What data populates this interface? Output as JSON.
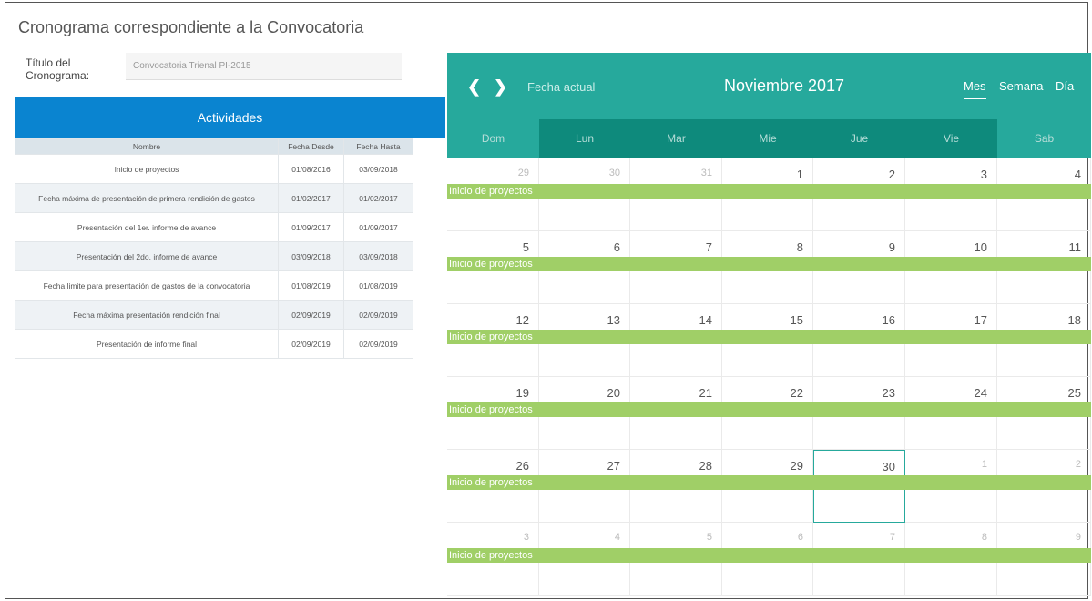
{
  "page": {
    "title": "Cronograma correspondiente a la Convocatoria"
  },
  "meta": {
    "label_line1": "Título del",
    "label_line2": "Cronograma:",
    "value": "Convocatoria Trienal PI-2015"
  },
  "activities": {
    "title": "Actividades",
    "columns": [
      "Nombre",
      "Fecha Desde",
      "Fecha Hasta"
    ],
    "rows": [
      [
        "Inicio de proyectos",
        "01/08/2016",
        "03/09/2018"
      ],
      [
        "Fecha máxima de presentación de primera rendición de gastos",
        "01/02/2017",
        "01/02/2017"
      ],
      [
        "Presentación del 1er. informe de avance",
        "01/09/2017",
        "01/09/2017"
      ],
      [
        "Presentación del 2do. informe de avance",
        "03/09/2018",
        "03/09/2018"
      ],
      [
        "Fecha limite para presentación de gastos de la convocatoria",
        "01/08/2019",
        "01/08/2019"
      ],
      [
        "Fecha máxima presentación rendición final",
        "02/09/2019",
        "02/09/2019"
      ],
      [
        "Presentación de informe final",
        "02/09/2019",
        "02/09/2019"
      ]
    ]
  },
  "calendar": {
    "prev_icon": "chevron-left-icon",
    "next_icon": "chevron-right-icon",
    "today_label": "Fecha actual",
    "month_label": "Noviembre 2017",
    "views": [
      "Mes",
      "Semana",
      "Día"
    ],
    "active_view": "Mes",
    "weekdays": [
      "Dom",
      "Lun",
      "Mar",
      "Mie",
      "Jue",
      "Vie",
      "Sab"
    ],
    "weeks": [
      [
        [
          "29",
          true
        ],
        [
          "30",
          true
        ],
        [
          "31",
          true
        ],
        [
          "1",
          false
        ],
        [
          "2",
          false
        ],
        [
          "3",
          false
        ],
        [
          "4",
          false
        ]
      ],
      [
        [
          "5",
          false
        ],
        [
          "6",
          false
        ],
        [
          "7",
          false
        ],
        [
          "8",
          false
        ],
        [
          "9",
          false
        ],
        [
          "10",
          false
        ],
        [
          "11",
          false
        ]
      ],
      [
        [
          "12",
          false
        ],
        [
          "13",
          false
        ],
        [
          "14",
          false
        ],
        [
          "15",
          false
        ],
        [
          "16",
          false
        ],
        [
          "17",
          false
        ],
        [
          "18",
          false
        ]
      ],
      [
        [
          "19",
          false
        ],
        [
          "20",
          false
        ],
        [
          "21",
          false
        ],
        [
          "22",
          false
        ],
        [
          "23",
          false
        ],
        [
          "24",
          false
        ],
        [
          "25",
          false
        ]
      ],
      [
        [
          "26",
          false
        ],
        [
          "27",
          false
        ],
        [
          "28",
          false
        ],
        [
          "29",
          false
        ],
        [
          "30",
          false
        ],
        [
          "1",
          true
        ],
        [
          "2",
          true
        ]
      ],
      [
        [
          "3",
          true
        ],
        [
          "4",
          true
        ],
        [
          "5",
          true
        ],
        [
          "6",
          true
        ],
        [
          "7",
          true
        ],
        [
          "8",
          true
        ],
        [
          "9",
          true
        ]
      ]
    ],
    "event_label": "Inicio de proyectos",
    "selected_day": "30",
    "colors": {
      "header": "#26a99c",
      "dark_column": "#0e8a7c",
      "event": "#a0cf67",
      "accent": "#0a84d0"
    }
  }
}
